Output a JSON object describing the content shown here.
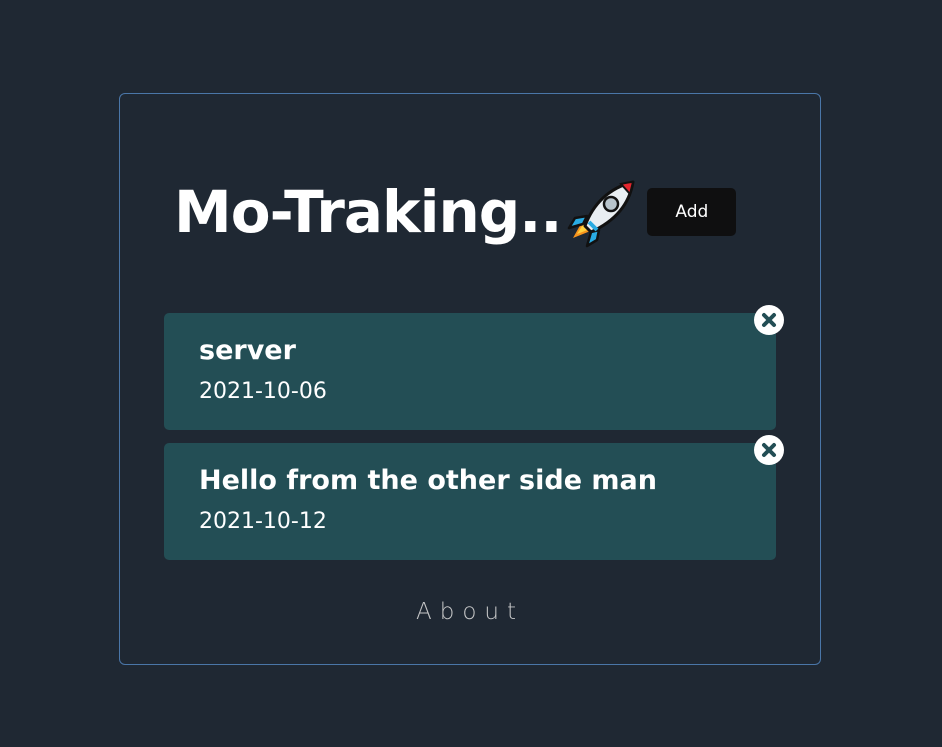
{
  "app": {
    "title": "Mo-Traking..",
    "add_label": "Add"
  },
  "tasks": [
    {
      "title": "server",
      "date": "2021-10-06"
    },
    {
      "title": "Hello from the other side man",
      "date": "2021-10-12"
    }
  ],
  "footer": {
    "about_label": "About"
  },
  "colors": {
    "background": "#1f2833",
    "card_border": "#4a76a8",
    "task_bg": "#234e55",
    "add_button_bg": "#0f0f10"
  },
  "icons": {
    "title_icon": "rocket-icon",
    "delete_icon": "close-circle-icon"
  }
}
